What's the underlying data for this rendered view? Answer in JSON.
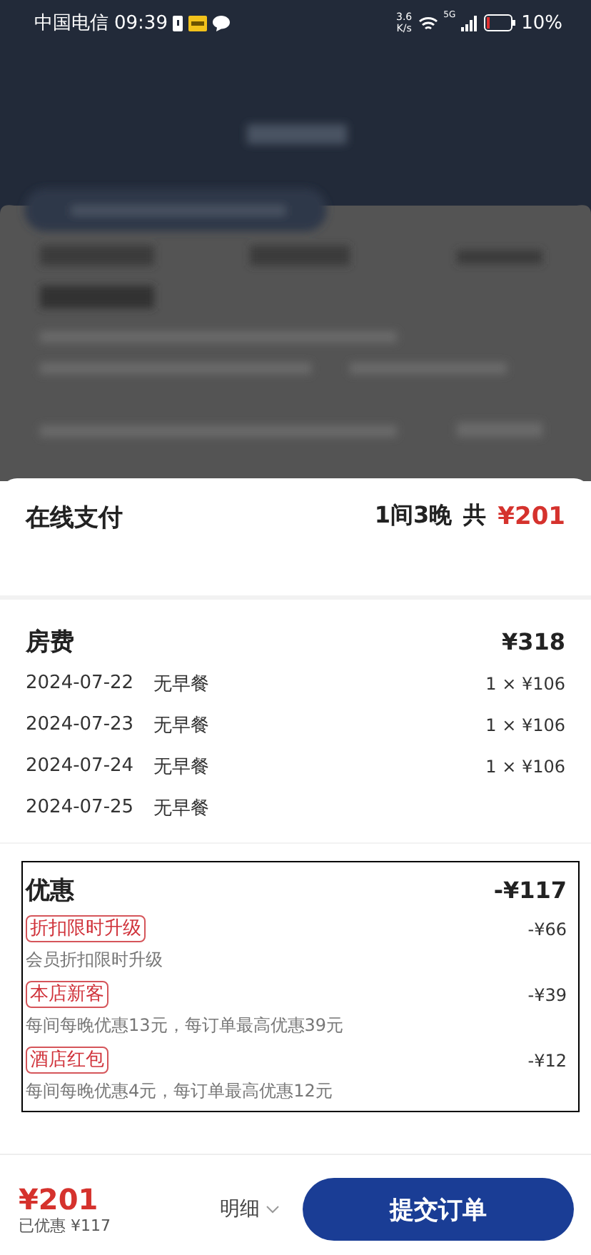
{
  "status_bar": {
    "carrier": "中国电信",
    "time": "09:39",
    "speed_value": "3.6",
    "speed_unit": "K/s",
    "network": "5G",
    "battery": "10%"
  },
  "sheet": {
    "title": "在线支付",
    "summary": "1间3晚",
    "total_label": "共",
    "total": "¥201"
  },
  "room_fee": {
    "title": "房费",
    "amount": "¥318",
    "nights": [
      {
        "date": "2024-07-22",
        "meal": "无早餐",
        "price": "1 × ¥106"
      },
      {
        "date": "2024-07-23",
        "meal": "无早餐",
        "price": "1 × ¥106"
      },
      {
        "date": "2024-07-24",
        "meal": "无早餐",
        "price": "1 × ¥106"
      },
      {
        "date": "2024-07-25",
        "meal": "无早餐"
      }
    ]
  },
  "discounts": {
    "title": "优惠",
    "amount": "-¥117",
    "items": [
      {
        "tag": "折扣限时升级",
        "amount": "-¥66",
        "note": "会员折扣限时升级"
      },
      {
        "tag": "本店新客",
        "amount": "-¥39",
        "note": "每间每晚优惠13元，每订单最高优惠39元"
      },
      {
        "tag": "酒店红包",
        "amount": "-¥12",
        "note": "每间每晚优惠4元，每订单最高优惠12元"
      }
    ]
  },
  "footer": {
    "price": "¥201",
    "saved": "已优惠 ¥117",
    "details": "明细",
    "submit": "提交订单"
  }
}
